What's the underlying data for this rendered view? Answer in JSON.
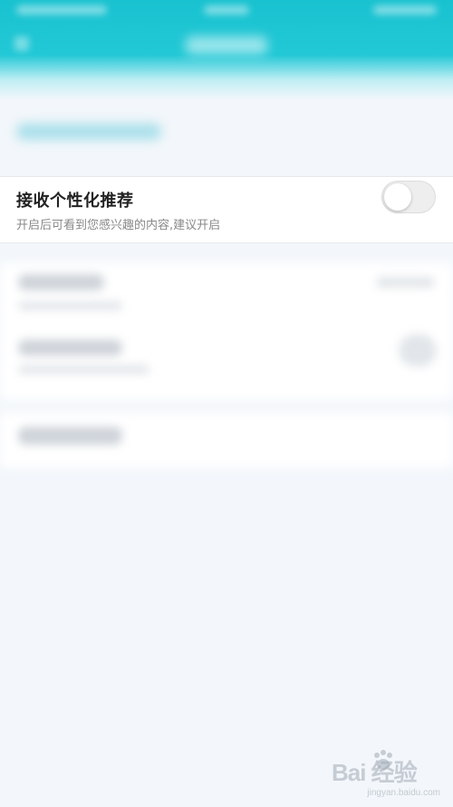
{
  "personalized_recommendation": {
    "title": "接收个性化推荐",
    "description": "开启后可看到您感兴趣的内容,建议开启",
    "toggle_on": false
  },
  "watermark": {
    "logo_text": "Bai 经验",
    "url": "jingyan.baidu.com"
  },
  "colors": {
    "header": "#22c8d6",
    "background": "#f3f7fb",
    "card": "#ffffff",
    "title_text": "#222222",
    "subtitle_text": "#888888",
    "toggle_track": "#eeeeee"
  },
  "icons": {
    "back": "back-arrow-icon",
    "paw": "baidu-paw-icon"
  }
}
